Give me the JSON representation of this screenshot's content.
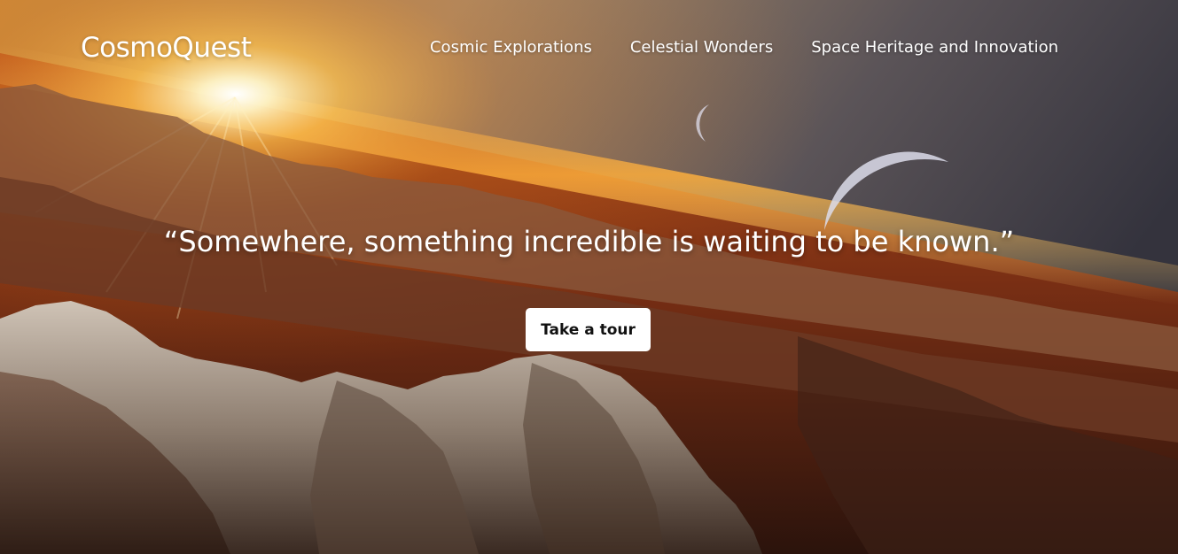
{
  "header": {
    "brand": "CosmoQuest",
    "nav": [
      {
        "label": "Cosmic Explorations"
      },
      {
        "label": "Celestial Wonders"
      },
      {
        "label": "Space Heritage and Innovation"
      }
    ]
  },
  "hero": {
    "quote": "“Somewhere, something incredible is waiting to be known.”",
    "cta_label": "Take a tour"
  },
  "colors": {
    "text": "#ffffff",
    "button_bg": "#ffffff",
    "button_text": "#111111",
    "sky_dark": "#3a3843",
    "sun_glow": "#ffb020"
  }
}
